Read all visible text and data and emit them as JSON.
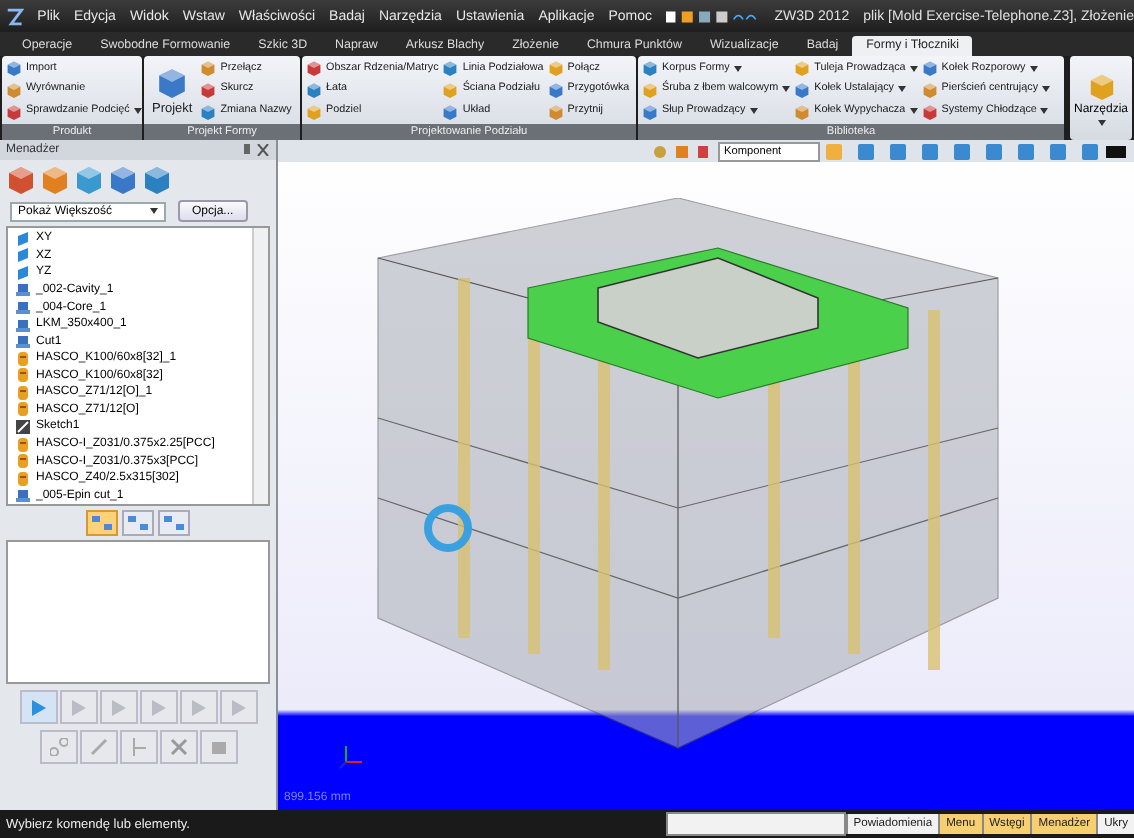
{
  "title_bar": {
    "menu": [
      "Plik",
      "Edycja",
      "Widok",
      "Wstaw",
      "Właściwości",
      "Badaj",
      "Narzędzia",
      "Ustawienia",
      "Aplikacje",
      "Pomoc"
    ],
    "app": "ZW3D 2012",
    "document": "plik [Mold Exercise-Telephone.Z3], Złożenie"
  },
  "tabs": [
    {
      "label": "Operacje",
      "selected": false
    },
    {
      "label": "Swobodne Formowanie",
      "selected": false
    },
    {
      "label": "Szkic 3D",
      "selected": false
    },
    {
      "label": "Napraw",
      "selected": false
    },
    {
      "label": "Arkusz Blachy",
      "selected": false
    },
    {
      "label": "Złożenie",
      "selected": false
    },
    {
      "label": "Chmura Punktów",
      "selected": false
    },
    {
      "label": "Wizualizacje",
      "selected": false
    },
    {
      "label": "Badaj",
      "selected": false
    },
    {
      "label": "Formy i Tłoczniki",
      "selected": true
    }
  ],
  "ribbon": [
    {
      "label": "Produkt",
      "columns": [
        [
          {
            "label": "Import",
            "has_menu": false
          },
          {
            "label": "Wyrównanie",
            "has_menu": false
          },
          {
            "label": "Sprawdzanie Podcięć",
            "has_menu": true
          }
        ]
      ]
    },
    {
      "label": "Projekt Formy",
      "large": {
        "label": "Projekt"
      },
      "columns": [
        [
          {
            "label": "Przełącz",
            "has_menu": false
          },
          {
            "label": "Skurcz",
            "has_menu": false
          },
          {
            "label": "Zmiana Nazwy",
            "has_menu": false
          }
        ]
      ]
    },
    {
      "label": "Projektowanie Podziału",
      "columns": [
        [
          {
            "label": "Obszar Rdzenia/Matryc",
            "has_menu": false
          },
          {
            "label": "Łata",
            "has_menu": false
          },
          {
            "label": "Podziel",
            "has_menu": false
          }
        ],
        [
          {
            "label": "Linia Podziałowa",
            "has_menu": false
          },
          {
            "label": "Ściana Podziału",
            "has_menu": false
          },
          {
            "label": "Układ",
            "has_menu": false
          }
        ],
        [
          {
            "label": "Połącz",
            "has_menu": false
          },
          {
            "label": "Przygotówka",
            "has_menu": false
          },
          {
            "label": "Przytnij",
            "has_menu": false
          }
        ]
      ]
    },
    {
      "label": "Biblioteka",
      "columns": [
        [
          {
            "label": "Korpus Formy",
            "has_menu": true
          },
          {
            "label": "Śruba z łbem walcowym",
            "has_menu": true
          },
          {
            "label": "Słup Prowadzący",
            "has_menu": true
          }
        ],
        [
          {
            "label": "Tuleja Prowadząca",
            "has_menu": true
          },
          {
            "label": "Kołek Ustalający",
            "has_menu": true
          },
          {
            "label": "Kołek Wypychacza",
            "has_menu": true
          }
        ],
        [
          {
            "label": "Kołek Rozporowy",
            "has_menu": true
          },
          {
            "label": "Pierścień centrujący",
            "has_menu": true
          },
          {
            "label": "Systemy Chłodzące",
            "has_menu": true
          }
        ]
      ]
    }
  ],
  "tools_button": {
    "label": "Narzędzia"
  },
  "manager": {
    "title": "Menadżer",
    "filter": "Pokaż Większość",
    "options_button": "Opcja...",
    "tree": [
      {
        "label": "XY",
        "kind": "plane"
      },
      {
        "label": "XZ",
        "kind": "plane"
      },
      {
        "label": "YZ",
        "kind": "plane"
      },
      {
        "label": "_002-Cavity_1",
        "kind": "part"
      },
      {
        "label": "_004-Core_1",
        "kind": "part"
      },
      {
        "label": "LKM_350x400_1",
        "kind": "part"
      },
      {
        "label": "Cut1",
        "kind": "part"
      },
      {
        "label": "HASCO_K100/60x8[32]_1",
        "kind": "component"
      },
      {
        "label": "HASCO_K100/60x8[32]",
        "kind": "component"
      },
      {
        "label": "HASCO_Z71/12[O]_1",
        "kind": "component"
      },
      {
        "label": "HASCO_Z71/12[O]",
        "kind": "component"
      },
      {
        "label": "Sketch1",
        "kind": "sketch"
      },
      {
        "label": "HASCO-I_Z031/0.375x2.25[PCC]",
        "kind": "component"
      },
      {
        "label": "HASCO-I_Z031/0.375x3[PCC]",
        "kind": "component"
      },
      {
        "label": "HASCO_Z40/2.5x315[302]",
        "kind": "component"
      },
      {
        "label": "_005-Epin cut_1",
        "kind": "part"
      }
    ],
    "views": [
      {
        "selected": true
      },
      {
        "selected": false
      },
      {
        "selected": false
      }
    ],
    "playback": [
      {
        "disabled": false
      },
      {
        "disabled": true
      },
      {
        "disabled": true
      },
      {
        "disabled": true
      },
      {
        "disabled": true
      },
      {
        "disabled": true
      }
    ]
  },
  "viewport": {
    "filter": "Komponent",
    "measure": "899.156 mm"
  },
  "status_bar": {
    "prompt": "Wybierz komendę lub elementy.",
    "buttons": [
      {
        "label": "Powiadomienia",
        "on": false
      },
      {
        "label": "Menu",
        "on": true
      },
      {
        "label": "Wstęgi",
        "on": true
      },
      {
        "label": "Menadżer",
        "on": true
      },
      {
        "label": "Ukry",
        "on": false
      }
    ]
  }
}
